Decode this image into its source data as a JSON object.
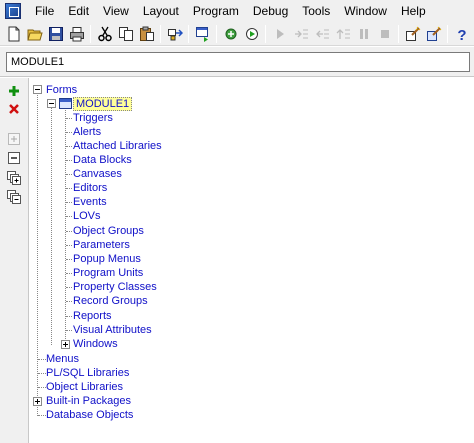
{
  "menubar": {
    "items": [
      "File",
      "Edit",
      "View",
      "Layout",
      "Program",
      "Debug",
      "Tools",
      "Window",
      "Help"
    ]
  },
  "toolbar": {
    "icons": [
      "new-icon",
      "open-icon",
      "save-icon",
      "print-icon",
      "cut-icon",
      "copy-icon",
      "paste-icon",
      "compile-icon",
      "run-form-icon",
      "step-icon",
      "run-icon",
      "step-into-icon",
      "step-over-icon",
      "step-out-icon",
      "go-icon",
      "stop-icon",
      "wizard-icon",
      "layout-wizard-icon",
      "help-icon"
    ]
  },
  "object_name": {
    "value": "MODULE1"
  },
  "sidebar": {
    "icons": [
      "create-icon",
      "delete-icon",
      "expand-icon",
      "collapse-icon",
      "expand-all-icon",
      "collapse-all-icon"
    ]
  },
  "tree": {
    "root": "Forms",
    "module": "MODULE1",
    "children": [
      "Triggers",
      "Alerts",
      "Attached Libraries",
      "Data Blocks",
      "Canvases",
      "Editors",
      "Events",
      "LOVs",
      "Object Groups",
      "Parameters",
      "Popup Menus",
      "Program Units",
      "Property Classes",
      "Record Groups",
      "Reports",
      "Visual Attributes",
      "Windows"
    ],
    "top_level": [
      "Menus",
      "PL/SQL Libraries",
      "Object Libraries",
      "Built-in Packages",
      "Database Objects"
    ]
  },
  "colors": {
    "link": "#1010c8",
    "selection": "#ffff99"
  }
}
